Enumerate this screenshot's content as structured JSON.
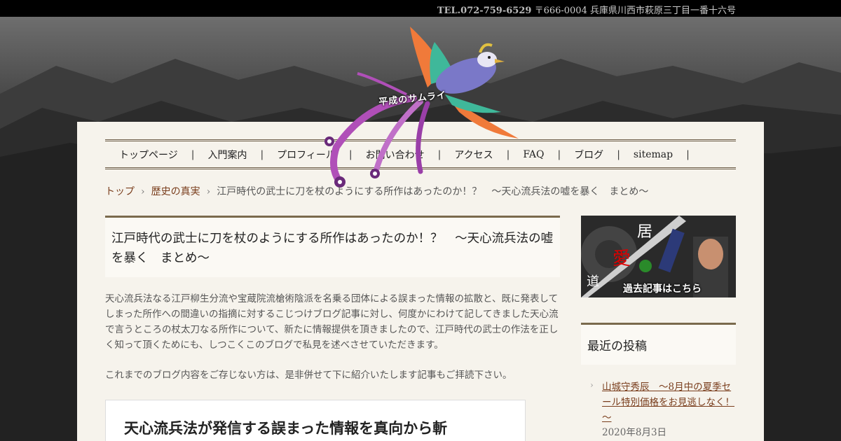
{
  "topbar": {
    "tel": "TEL.072-759-6529",
    "address": "〒666-0004 兵庫県川西市萩原三丁目一番十六号"
  },
  "logo": {
    "text": "平成のサムライ"
  },
  "nav": {
    "items": [
      "トップページ",
      "入門案内",
      "プロフィール",
      "お問い合わせ",
      "アクセス",
      "FAQ",
      "ブログ",
      "sitemap"
    ]
  },
  "breadcrumb": {
    "top": "トップ",
    "category": "歴史の真実",
    "current": "江戸時代の武士に刀を杖のようにする所作はあったのか！？　～天心流兵法の嘘を暴く　まとめ～"
  },
  "article": {
    "title": "江戸時代の武士に刀を杖のようにする所作はあったのか！？　～天心流兵法の嘘を暴く　まとめ～",
    "p1": "天心流兵法なる江戸柳生分流や宝蔵院流槍術陰派を名乗る団体による誤まった情報の拡散と、既に発表してしまった所作への間違いの指摘に対するこじつけブログ記事に対し、何度かにわけて記してきました天心流で言うところの杖太刀なる所作について、新たに情報提供を頂きましたので、江戸時代の武士の作法を正しく知って頂くためにも、しつこくこのブログで私見を述べさせていただきます。",
    "p2": "これまでのブログ内容をご存じない方は、是非併せて下に紹介いたします記事もご拝読下さい。",
    "card_title": "天心流兵法が発信する誤まった情報を真向から斬"
  },
  "sidebar": {
    "banner_text": "過去記事はこちら",
    "recent_heading": "最近の投稿",
    "recent_title": "山城守秀辰　～8月中の夏季セール特別価格をお見逃しなく！～",
    "recent_date": "2020年8月3日"
  },
  "colors": {
    "accent": "#7a3e1d",
    "panel": "#f6f3ec",
    "rule": "#7a6a4d"
  }
}
